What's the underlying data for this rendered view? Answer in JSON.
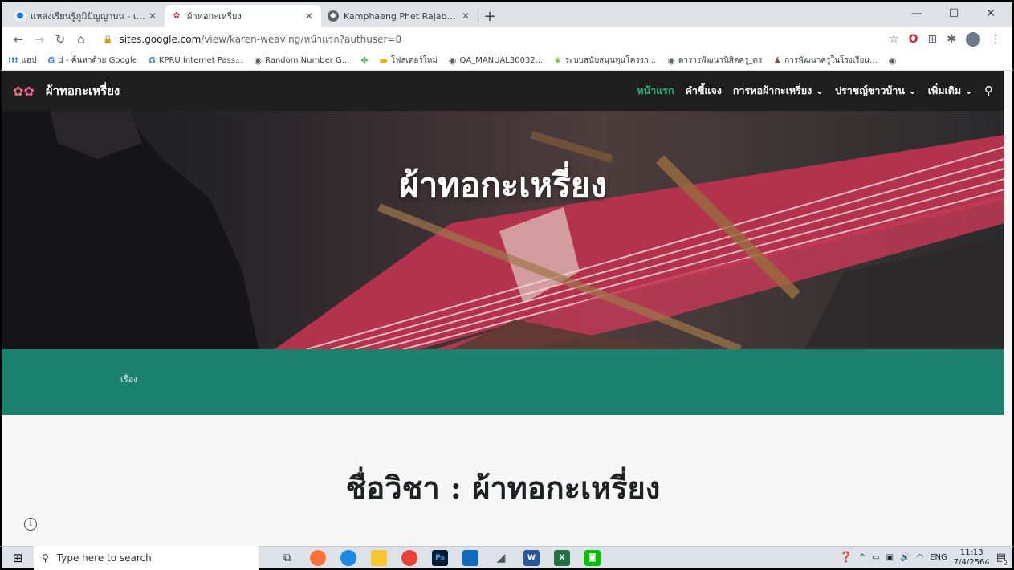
{
  "browser": {
    "tabs": [
      {
        "title": "แหล่งเรียนรู้ภูมิปัญญาบน - เกี่ยวกับโครงการ",
        "favicon": "globe-icon",
        "active": false
      },
      {
        "title": "ผ้าทอกะเหรี่ยง",
        "favicon": "site-logo-icon",
        "active": true
      },
      {
        "title": "Kamphaeng Phet Rajabhat Unive",
        "favicon": "university-icon",
        "active": false
      }
    ],
    "new_tab": "+",
    "window_controls": {
      "minimize": "—",
      "maximize": "☐",
      "close": "✕"
    },
    "url": {
      "host": "sites.google.com",
      "path": "/view/karen-weaving/หน้าแรก?authuser=0"
    },
    "bookmarks": [
      {
        "label": "แอป",
        "icon": "apps-icon"
      },
      {
        "label": "d - ค้นหาด้วย Google",
        "icon": "google-icon"
      },
      {
        "label": "KPRU Internet Pass...",
        "icon": "google-icon"
      },
      {
        "label": "Random Number G...",
        "icon": "globe-icon"
      },
      {
        "label": "",
        "icon": "pinwheel-icon"
      },
      {
        "label": "โฟลเดอร์ใหม่",
        "icon": "folder-icon"
      },
      {
        "label": "QA_MANUAL30032...",
        "icon": "globe-icon"
      },
      {
        "label": "ระบบสนับสนุนทุนโครงก...",
        "icon": "leaf-icon"
      },
      {
        "label": "ตารางพัฒนานิสิตครู_ตร",
        "icon": "globe-icon"
      },
      {
        "label": "การพัฒนาครูในโรงเรียน...",
        "icon": "person-icon"
      },
      {
        "label": "",
        "icon": "globe-icon"
      }
    ]
  },
  "site": {
    "title": "ผ้าทอกะเหรี่ยง",
    "nav": [
      {
        "label": "หน้าแรก",
        "current": true,
        "dropdown": false
      },
      {
        "label": "คำชี้แจง",
        "current": false,
        "dropdown": false
      },
      {
        "label": "การทอผ้ากะเหรี่ยง",
        "current": false,
        "dropdown": true
      },
      {
        "label": "ปราชญ์ชาวบ้าน",
        "current": false,
        "dropdown": true
      },
      {
        "label": "เพิ่มเติม",
        "current": false,
        "dropdown": true
      }
    ],
    "hero_title": "ผ้าทอกะเหรี่ยง",
    "teal_text": "เรื่อง",
    "course_title": "ชื่อวิชา : ผ้าทอกะเหรี่ยง",
    "accent_color": "#2ab27b",
    "teal_color": "#1d8170"
  },
  "taskbar": {
    "search_placeholder": "Type here to search",
    "lang": "ENG",
    "time": "11:13",
    "date": "7/4/2564",
    "notification_count": "2"
  }
}
